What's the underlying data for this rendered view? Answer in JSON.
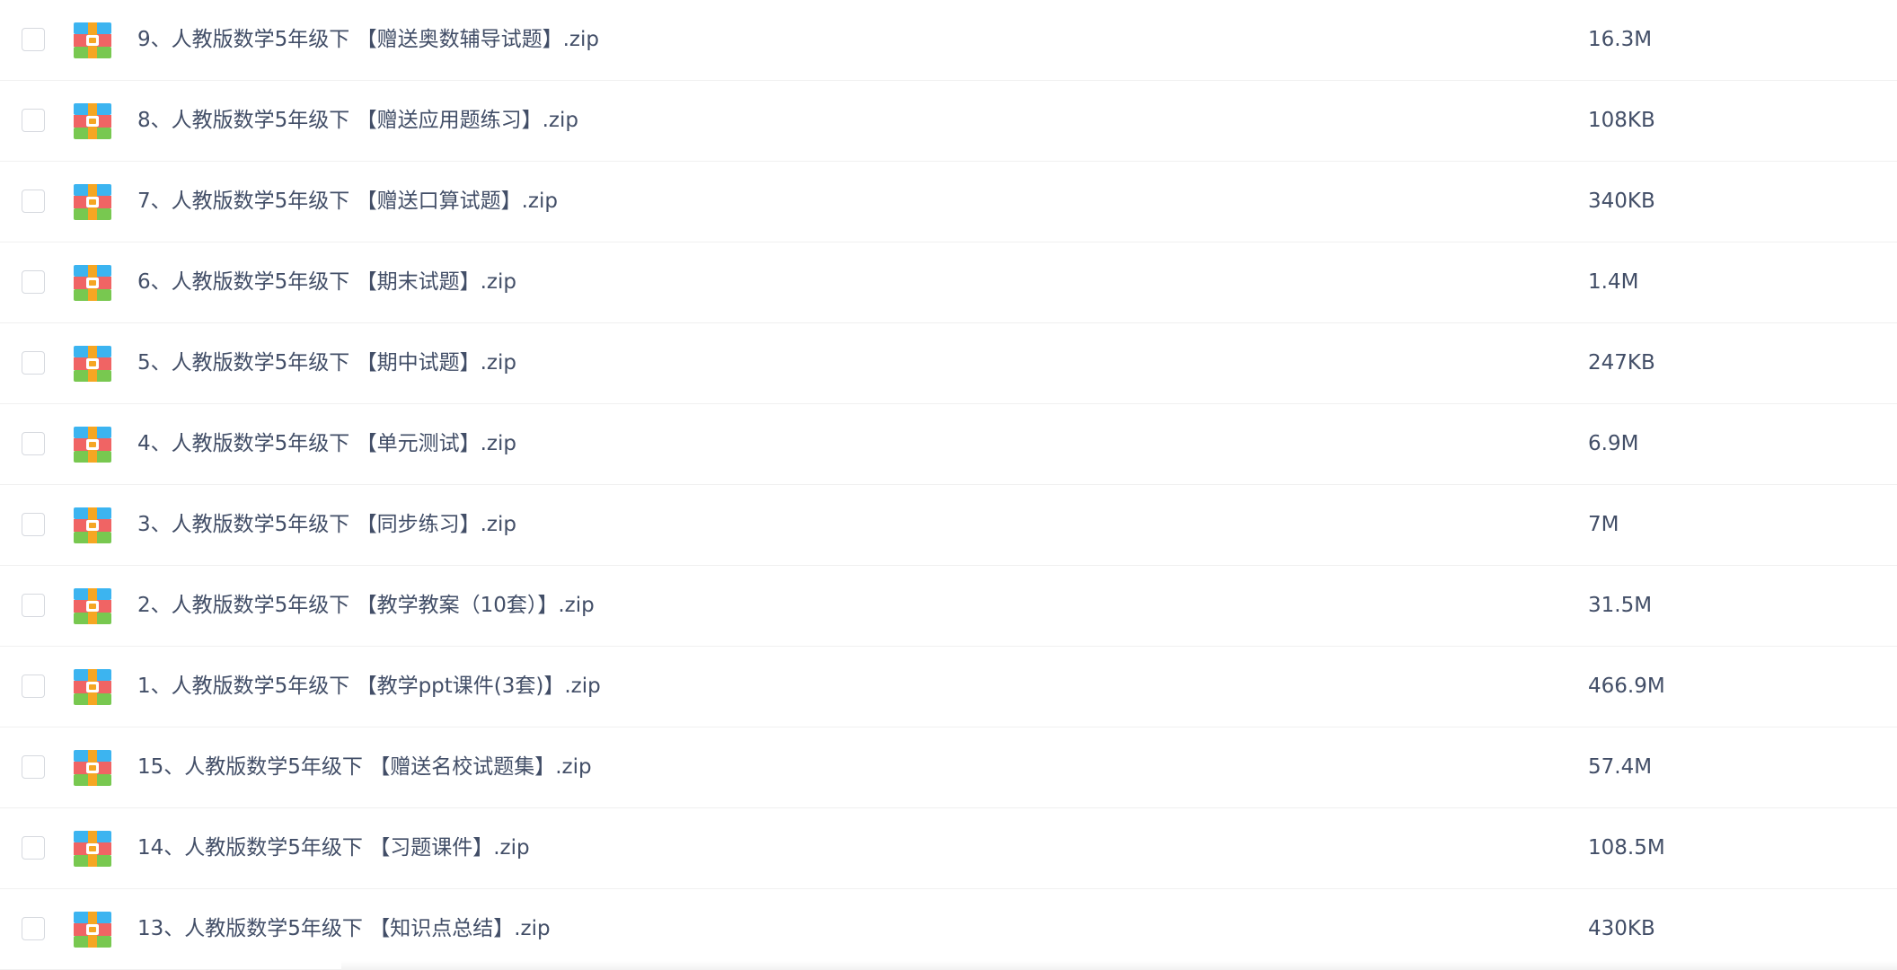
{
  "colors": {
    "text": "#424e67",
    "divider": "#f0f0f0",
    "checkbox_border": "#d6d9df",
    "zip_blue": "#3cb4f0",
    "zip_red": "#f06464",
    "zip_green": "#78c850",
    "zip_band": "#f5a623"
  },
  "icons": {
    "checkbox": "checkbox-icon",
    "file": "zip-archive-icon"
  },
  "files": [
    {
      "name": "9、人教版数学5年级下 【赠送奥数辅导试题】.zip",
      "size": "16.3M"
    },
    {
      "name": "8、人教版数学5年级下 【赠送应用题练习】.zip",
      "size": "108KB"
    },
    {
      "name": "7、人教版数学5年级下 【赠送口算试题】.zip",
      "size": "340KB"
    },
    {
      "name": "6、人教版数学5年级下 【期末试题】.zip",
      "size": "1.4M"
    },
    {
      "name": "5、人教版数学5年级下 【期中试题】.zip",
      "size": "247KB"
    },
    {
      "name": "4、人教版数学5年级下 【单元测试】.zip",
      "size": "6.9M"
    },
    {
      "name": "3、人教版数学5年级下 【同步练习】.zip",
      "size": "7M"
    },
    {
      "name": "2、人教版数学5年级下 【教学教案（10套）】.zip",
      "size": "31.5M"
    },
    {
      "name": "1、人教版数学5年级下 【教学ppt课件(3套)】.zip",
      "size": "466.9M"
    },
    {
      "name": "15、人教版数学5年级下 【赠送名校试题集】.zip",
      "size": "57.4M"
    },
    {
      "name": "14、人教版数学5年级下 【习题课件】.zip",
      "size": "108.5M"
    },
    {
      "name": "13、人教版数学5年级下 【知识点总结】.zip",
      "size": "430KB"
    }
  ]
}
